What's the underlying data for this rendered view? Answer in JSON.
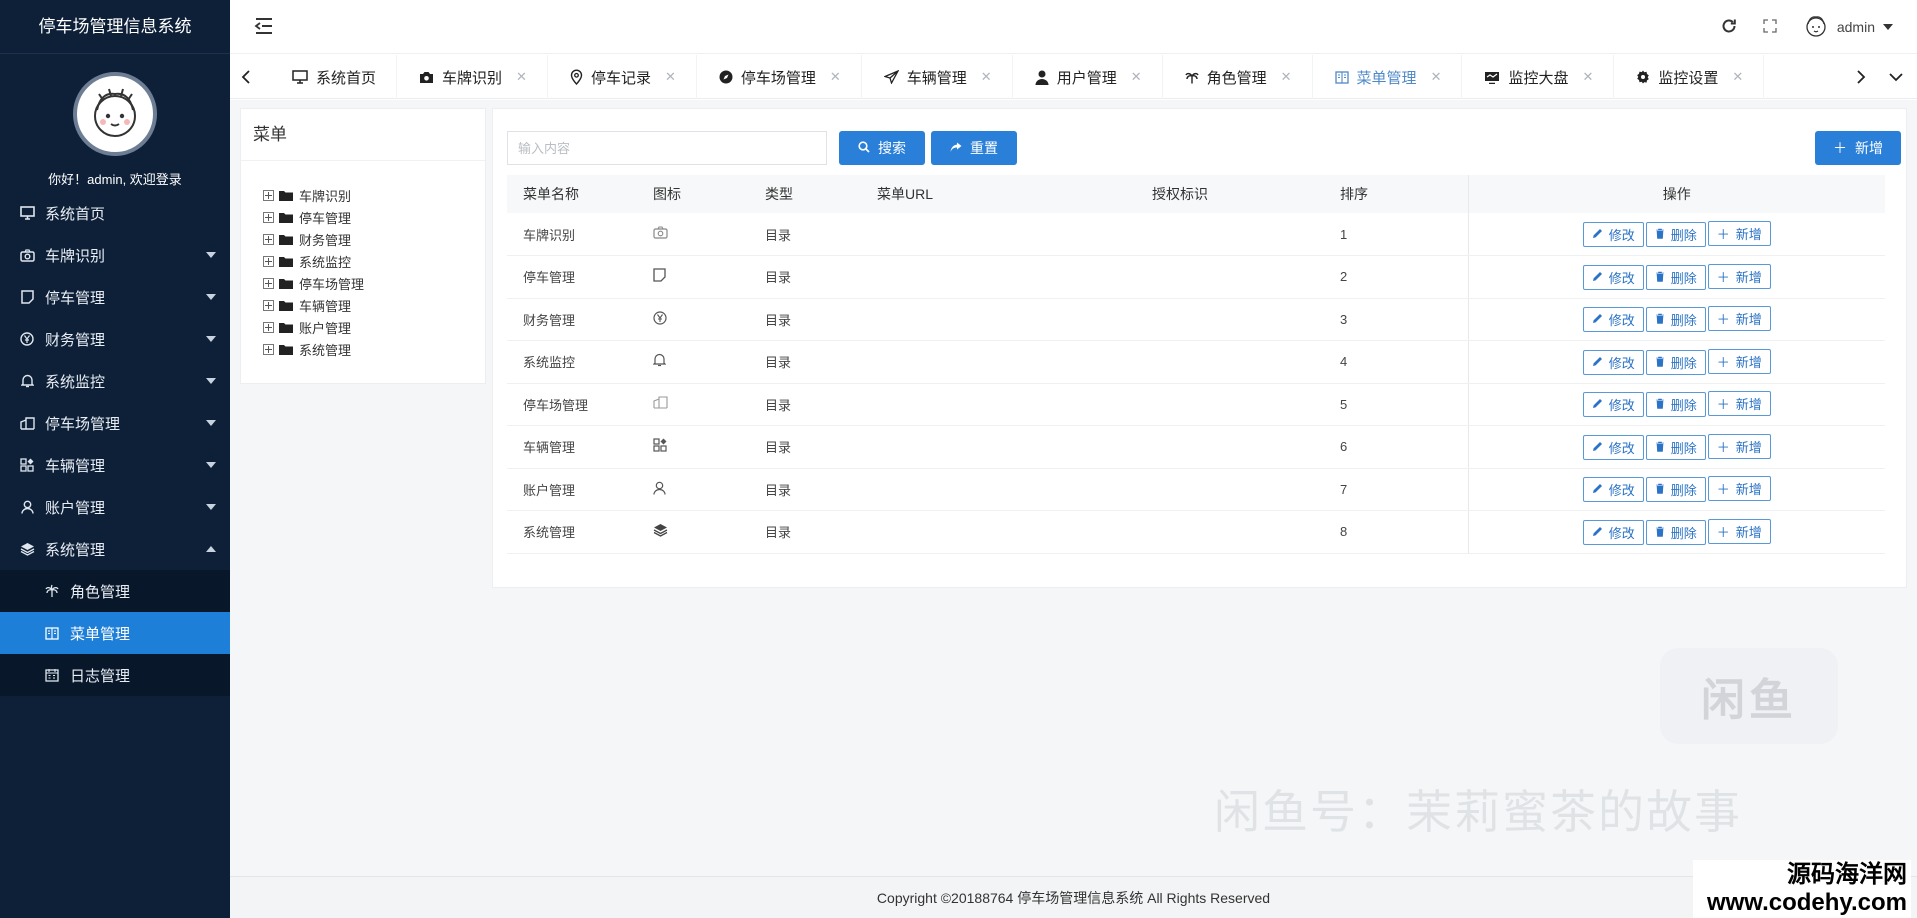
{
  "app": {
    "title": "停车场管理信息系统",
    "greeting": "你好！admin, 欢迎登录"
  },
  "sidebar": {
    "items": [
      {
        "label": "系统首页",
        "icon": "monitor-icon"
      },
      {
        "label": "车牌识别",
        "icon": "camera-icon"
      },
      {
        "label": "停车管理",
        "icon": "note-icon"
      },
      {
        "label": "财务管理",
        "icon": "yen-icon"
      },
      {
        "label": "系统监控",
        "icon": "bell-icon"
      },
      {
        "label": "停车场管理",
        "icon": "building-icon"
      },
      {
        "label": "车辆管理",
        "icon": "grid-icon"
      },
      {
        "label": "账户管理",
        "icon": "user-icon"
      },
      {
        "label": "系统管理",
        "icon": "layers-icon"
      }
    ],
    "subitems": [
      {
        "label": "角色管理",
        "icon": "palm-icon"
      },
      {
        "label": "菜单管理",
        "icon": "book-icon"
      },
      {
        "label": "日志管理",
        "icon": "calendar-icon"
      }
    ]
  },
  "header": {
    "user": "admin"
  },
  "tabs": [
    {
      "label": "系统首页"
    },
    {
      "label": "车牌识别"
    },
    {
      "label": "停车记录"
    },
    {
      "label": "停车场管理"
    },
    {
      "label": "车辆管理"
    },
    {
      "label": "用户管理"
    },
    {
      "label": "角色管理"
    },
    {
      "label": "菜单管理"
    },
    {
      "label": "监控大盘"
    },
    {
      "label": "监控设置"
    }
  ],
  "tree": {
    "title": "菜单",
    "nodes": [
      "车牌识别",
      "停车管理",
      "财务管理",
      "系统监控",
      "停车场管理",
      "车辆管理",
      "账户管理",
      "系统管理"
    ]
  },
  "search": {
    "placeholder": "输入内容",
    "search_label": "搜索",
    "reset_label": "重置",
    "add_label": "新增"
  },
  "table": {
    "headers": [
      "菜单名称",
      "图标",
      "类型",
      "菜单URL",
      "授权标识",
      "排序",
      "操作"
    ],
    "rows": [
      {
        "name": "车牌识别",
        "icon": "camera-icon",
        "type": "目录",
        "url": "",
        "perm": "",
        "order": "1"
      },
      {
        "name": "停车管理",
        "icon": "note-icon",
        "type": "目录",
        "url": "",
        "perm": "",
        "order": "2"
      },
      {
        "name": "财务管理",
        "icon": "yen-icon",
        "type": "目录",
        "url": "",
        "perm": "",
        "order": "3"
      },
      {
        "name": "系统监控",
        "icon": "bell-icon",
        "type": "目录",
        "url": "",
        "perm": "",
        "order": "4"
      },
      {
        "name": "停车场管理",
        "icon": "building-icon",
        "type": "目录",
        "url": "",
        "perm": "",
        "order": "5"
      },
      {
        "name": "车辆管理",
        "icon": "grid-icon",
        "type": "目录",
        "url": "",
        "perm": "",
        "order": "6"
      },
      {
        "name": "账户管理",
        "icon": "user-icon",
        "type": "目录",
        "url": "",
        "perm": "",
        "order": "7"
      },
      {
        "name": "系统管理",
        "icon": "layers-icon",
        "type": "目录",
        "url": "",
        "perm": "",
        "order": "8"
      }
    ],
    "actions": {
      "edit": "修改",
      "delete": "删除",
      "add": "新增"
    }
  },
  "footer": {
    "text": "Copyright ©20188764 停车场管理信息系统 All Rights Reserved"
  },
  "watermarks": {
    "logo": "闲鱼",
    "text": "闲鱼号：茉莉蜜茶的故事",
    "site_cn": "源码海洋网",
    "site_url": "www.codehy.com"
  },
  "colors": {
    "sidebar_bg": "#0e2038",
    "accent": "#1e7fd8",
    "button": "#2a7fd8"
  }
}
